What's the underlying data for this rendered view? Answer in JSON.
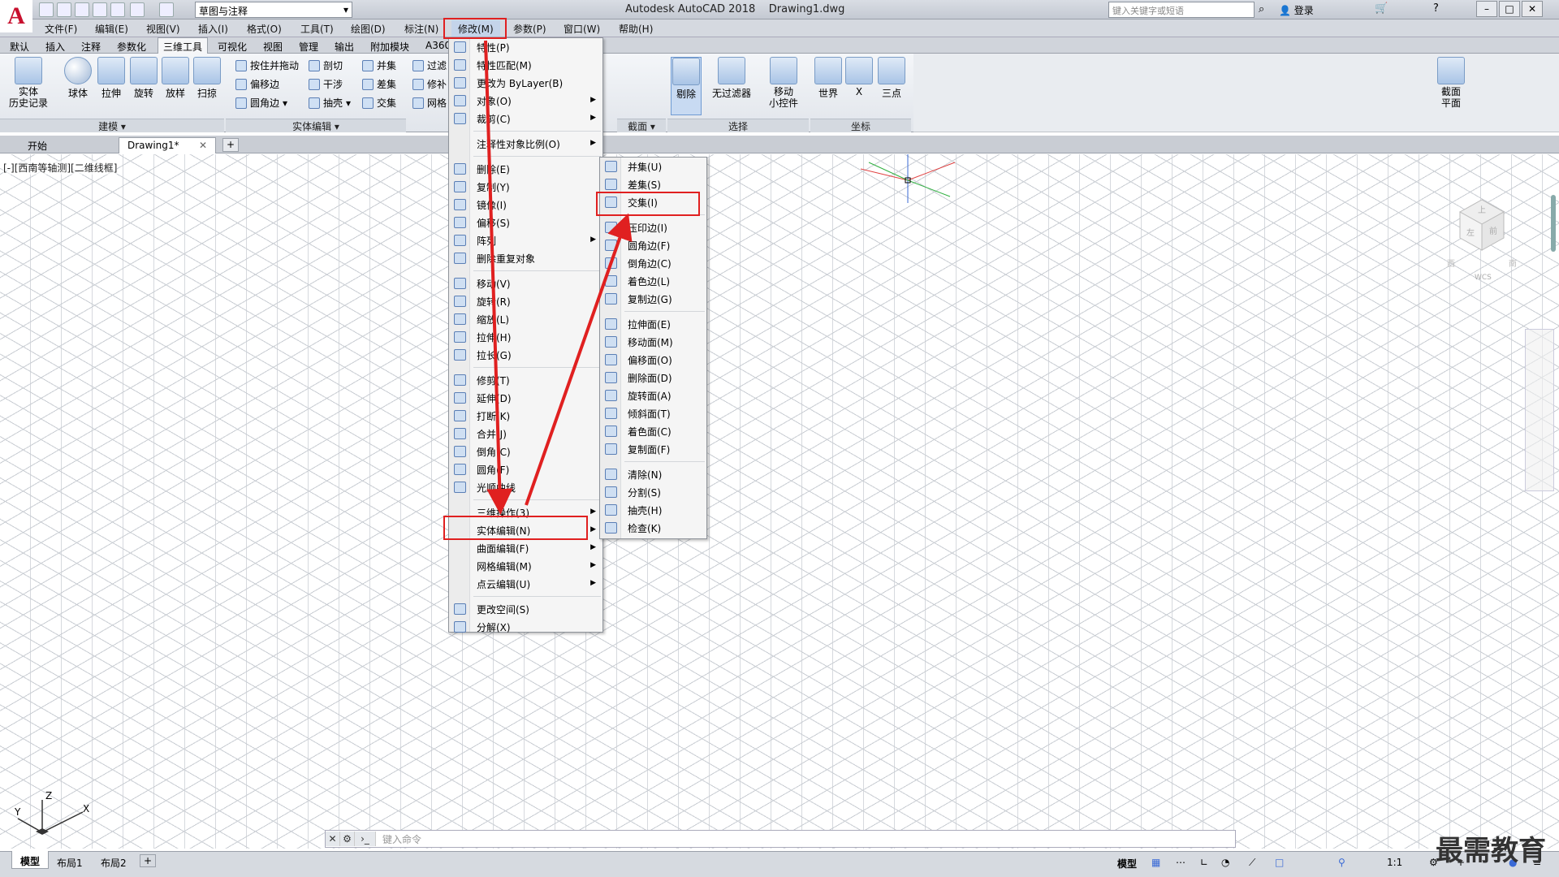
{
  "app": {
    "logo": "A",
    "title": "Autodesk AutoCAD 2018",
    "doc": "Drawing1.dwg",
    "workspace": "草图与注释",
    "search_placeholder": "键入关键字或短语",
    "login": "登录"
  },
  "menubar": [
    "文件(F)",
    "编辑(E)",
    "视图(V)",
    "插入(I)",
    "格式(O)",
    "工具(T)",
    "绘图(D)",
    "标注(N)",
    "修改(M)",
    "参数(P)",
    "窗口(W)",
    "帮助(H)"
  ],
  "ribbon_tabs": [
    "默认",
    "插入",
    "注释",
    "参数化",
    "三维工具",
    "可视化",
    "视图",
    "管理",
    "输出",
    "附加模块",
    "A360"
  ],
  "ribbon": {
    "history": "实体\n历史记录",
    "modeling": [
      "球体",
      "拉伸",
      "旋转",
      "放样",
      "扫掠"
    ],
    "modeling_title": "建模",
    "solid_edit_col1": [
      "按住并拖动",
      "偏移边",
      "圆角边"
    ],
    "solid_edit_col2": [
      "剖切",
      "干涉",
      "抽壳"
    ],
    "solid_edit_col3": [
      "并集",
      "差集",
      "交集"
    ],
    "solid_edit_title": "实体编辑",
    "partial_col4": [
      "过滤",
      "修补",
      "网格"
    ],
    "section_btn": "截面\n平面",
    "section_title": "截面",
    "select_btns": [
      "剔除",
      "无过滤器",
      "移动\n小控件"
    ],
    "select_title": "选择",
    "coord_btns": [
      "世界",
      "X",
      "三点"
    ],
    "coord_title": "坐标"
  },
  "doc_tabs": [
    "开始",
    "Drawing1*"
  ],
  "view_label": "[-][西南等轴测][二维线框]",
  "modify_menu": {
    "group1": [
      "特性(P)",
      "特性匹配(M)",
      "更改为 ByLayer(B)",
      "对象(O)",
      "裁剪(C)"
    ],
    "group2": [
      "注释性对象比例(O)"
    ],
    "group3": [
      "删除(E)",
      "复制(Y)",
      "镜像(I)",
      "偏移(S)",
      "阵列",
      "删除重复对象"
    ],
    "group4": [
      "移动(V)",
      "旋转(R)",
      "缩放(L)",
      "拉伸(H)",
      "拉长(G)"
    ],
    "group5": [
      "修剪(T)",
      "延伸(D)",
      "打断(K)",
      "合并(J)",
      "倒角(C)",
      "圆角(F)",
      "光顺曲线"
    ],
    "group6": [
      "三维操作(3)",
      "实体编辑(N)",
      "曲面编辑(F)",
      "网格编辑(M)",
      "点云编辑(U)"
    ],
    "group7": [
      "更改空间(S)",
      "分解(X)"
    ]
  },
  "solid_edit_menu": {
    "group1": [
      "并集(U)",
      "差集(S)",
      "交集(I)"
    ],
    "group2": [
      "压印边(I)",
      "圆角边(F)",
      "倒角边(C)",
      "着色边(L)",
      "复制边(G)"
    ],
    "group3": [
      "拉伸面(E)",
      "移动面(M)",
      "偏移面(O)",
      "删除面(D)",
      "旋转面(A)",
      "倾斜面(T)",
      "着色面(C)",
      "复制面(F)"
    ],
    "group4": [
      "清除(N)",
      "分割(S)",
      "抽壳(H)",
      "检查(K)"
    ]
  },
  "command_placeholder": "键入命令",
  "layout_tabs": [
    "模型",
    "布局1",
    "布局2"
  ],
  "status": {
    "model": "模型",
    "scale": "1:1"
  },
  "viewcube": {
    "top": "上",
    "front": "前",
    "left": "左",
    "west": "西",
    "south": "南",
    "wcs": "WCS"
  },
  "ucs": {
    "x": "X",
    "y": "Y",
    "z": "Z"
  },
  "watermark": "最需教育",
  "colors": {
    "highlight": "#e02020",
    "arrow": "#e02020",
    "grid": "#c9cdd3"
  }
}
